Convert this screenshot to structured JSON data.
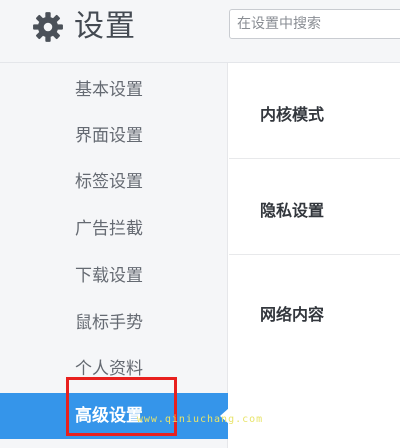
{
  "header": {
    "title": "设置",
    "icon": "gear-icon",
    "search_placeholder": "在设置中搜索"
  },
  "sidebar": {
    "items": [
      {
        "label": "基本设置"
      },
      {
        "label": "界面设置"
      },
      {
        "label": "标签设置"
      },
      {
        "label": "广告拦截"
      },
      {
        "label": "下载设置"
      },
      {
        "label": "鼠标手势"
      },
      {
        "label": "个人资料"
      },
      {
        "label": "高级设置",
        "active": true
      }
    ]
  },
  "main": {
    "sections": [
      {
        "title": "内核模式"
      },
      {
        "title": "隐私设置"
      },
      {
        "title": "网络内容"
      }
    ]
  },
  "watermark": {
    "text": "www.qiniuchang.com"
  },
  "colors": {
    "accent": "#3595ea",
    "highlight_box": "#e8201e",
    "sidebar_bg": "#f5f6f8"
  }
}
